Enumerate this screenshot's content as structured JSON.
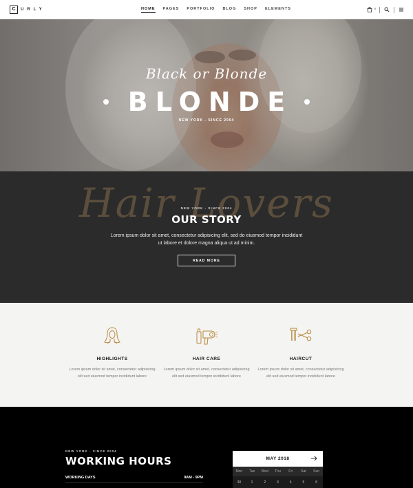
{
  "header": {
    "logo_initial": "C",
    "logo_rest": "URLY",
    "nav": [
      "HOME",
      "PAGES",
      "PORTFOLIO",
      "BLOG",
      "SHOP",
      "ELEMENTS"
    ],
    "active_nav": "HOME",
    "cart_count": "0"
  },
  "hero": {
    "script": "Black or Blonde",
    "title": "BLONDE",
    "subtitle": "NEW YORK - SINCE 2004"
  },
  "story": {
    "background_script": "Hair Lovers",
    "subtitle": "NEW YORK - SINCE 2004",
    "title": "OUR STORY",
    "text": "Lorem ipsum dolor sit amet, consectetur adipisicing elit, sed do eiusmod tempor incididunt ut labore et dolore magna aliqua ut ad minim.",
    "button": "READ MORE"
  },
  "features": [
    {
      "icon": "woman-hair-icon",
      "title": "HIGHLIGHTS",
      "text": "Lorem ipsum dolor sit amet, consectetur adipisicing elit sed eiusmod tempor incididunt labore"
    },
    {
      "icon": "hair-dryer-icon",
      "title": "HAIR CARE",
      "text": "Lorem ipsum dolor sit amet, consectetur adipisicing elit sed eiusmod tempor incididunt labore"
    },
    {
      "icon": "comb-scissors-icon",
      "title": "HAIRCUT",
      "text": "Lorem ipsum dolor sit amet, consectetur adipisicing elit sed eiusmod tempor incididunt labore"
    }
  ],
  "hours": {
    "subtitle": "NEW YORK - SINCE 2004",
    "title": "WORKING HOURS",
    "row_label": "WORKING DAYS",
    "row_value": "9AM - 9PM"
  },
  "calendar": {
    "month": "MAY 2018",
    "days": [
      "Mon",
      "Tue",
      "Wed",
      "Thu",
      "Fri",
      "Sat",
      "Sun"
    ],
    "dates": [
      "30",
      "1",
      "2",
      "3",
      "4",
      "5",
      "6"
    ]
  },
  "colors": {
    "accent_gold": "#b8893c",
    "dark_section": "#2b2b2b",
    "light_section": "#f4f4f2"
  }
}
